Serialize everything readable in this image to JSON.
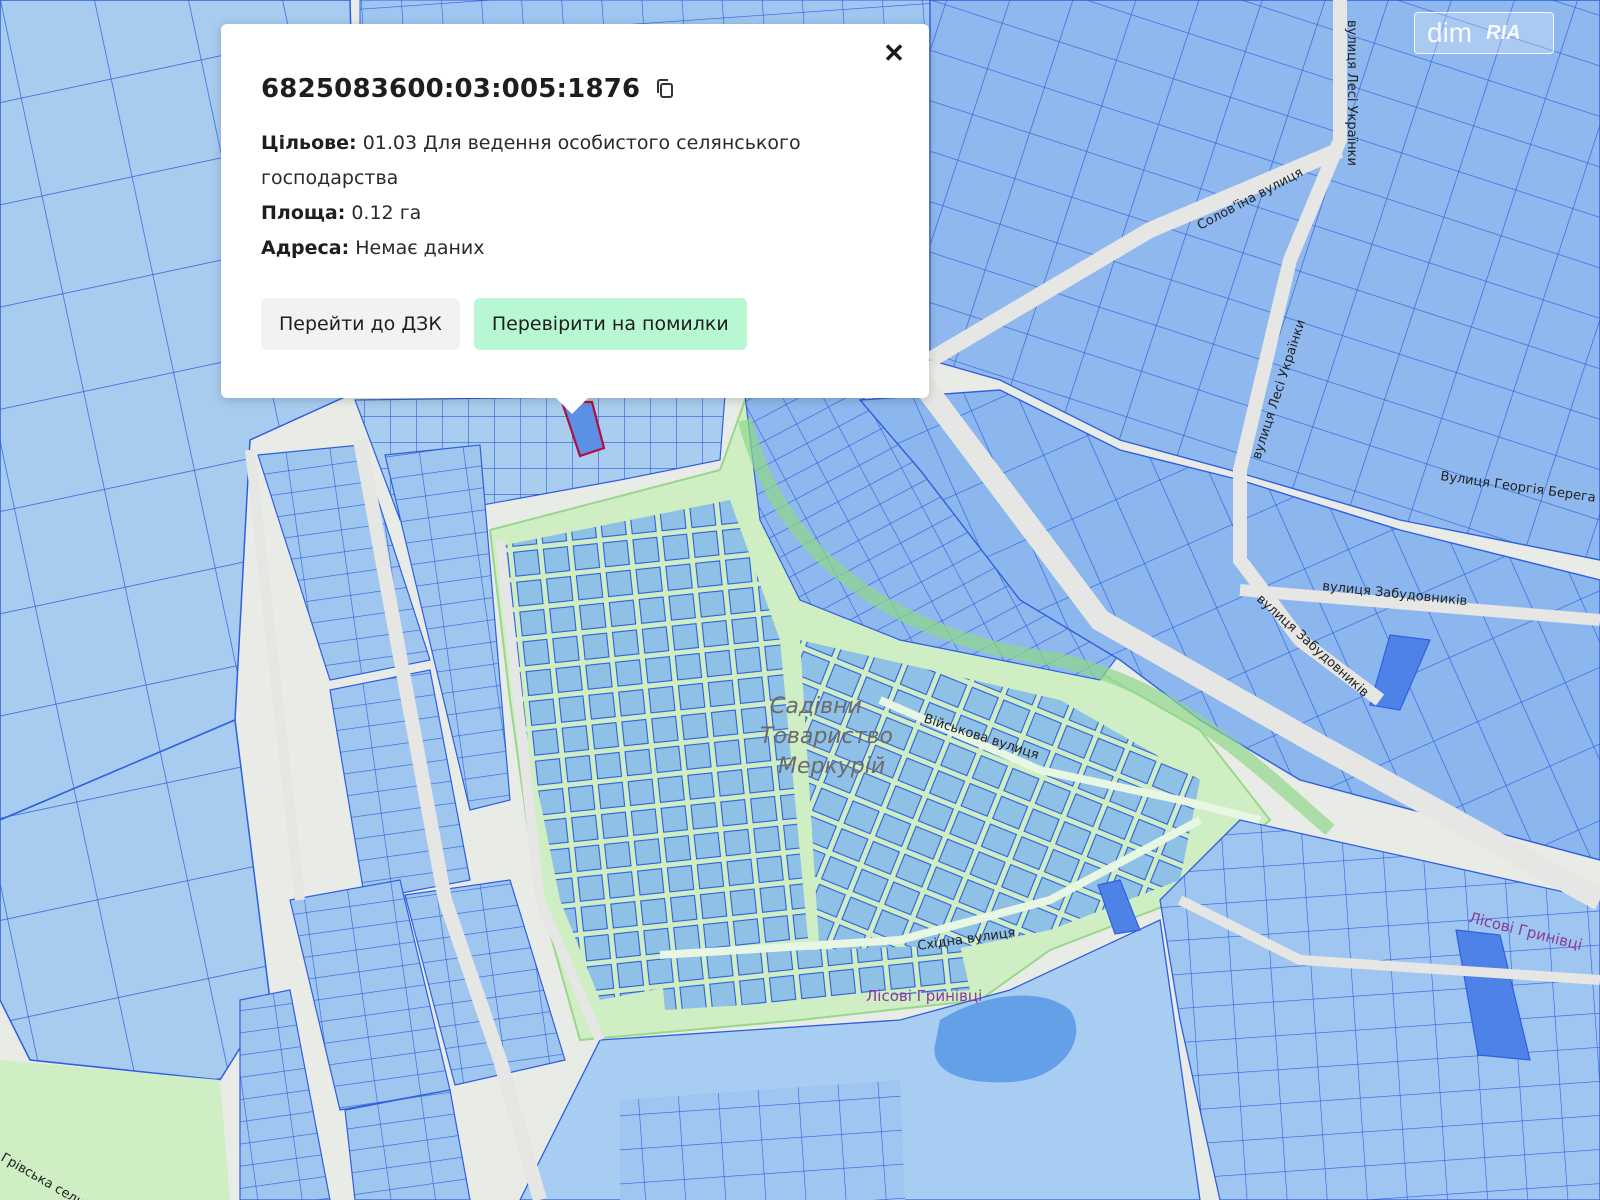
{
  "popup": {
    "parcel_id": "6825083600:03:005:1876",
    "purpose_label": "Цільове:",
    "purpose_value": "01.03 Для ведення особистого селянського господарства",
    "area_label": "Площа:",
    "area_value": "0.12 га",
    "address_label": "Адреса:",
    "address_value": "Немає даних",
    "btn_dzk": "Перейти до ДЗК",
    "btn_check": "Перевірити на помилки",
    "close_icon": "close-icon",
    "copy_icon": "copy-icon"
  },
  "map": {
    "labels": {
      "garden_1": "Садівни",
      "garden_2": "Товариство",
      "garden_3": "Меркурій",
      "street_viyskova": "Військова вулиця",
      "street_skhidna": "Східна вулиця",
      "lisovi_1": "Лісові Гринівці",
      "lisovi_2": "Лісові Гринівці",
      "street_solovyina": "Солов'їна вулиця",
      "street_lesi_1": "вулиця Лесі Українки",
      "street_lesi_2": "вулиця Лесі Українки",
      "street_berehova": "Вулиця Георгія Берега",
      "street_zabud_1": "вулиця Забудовників",
      "street_zabud_2": "вулиця Забудовників",
      "street_hrivska": "Грівська селищна"
    },
    "colors": {
      "parcel_fill": "#8fb8ee",
      "parcel_stroke": "#2f5fe0",
      "selected_stroke": "#b0103a",
      "green_zone": "#cfeec4",
      "water": "#5b9be6"
    }
  },
  "watermark": {
    "dim": "dim",
    "ria": "RIA"
  }
}
